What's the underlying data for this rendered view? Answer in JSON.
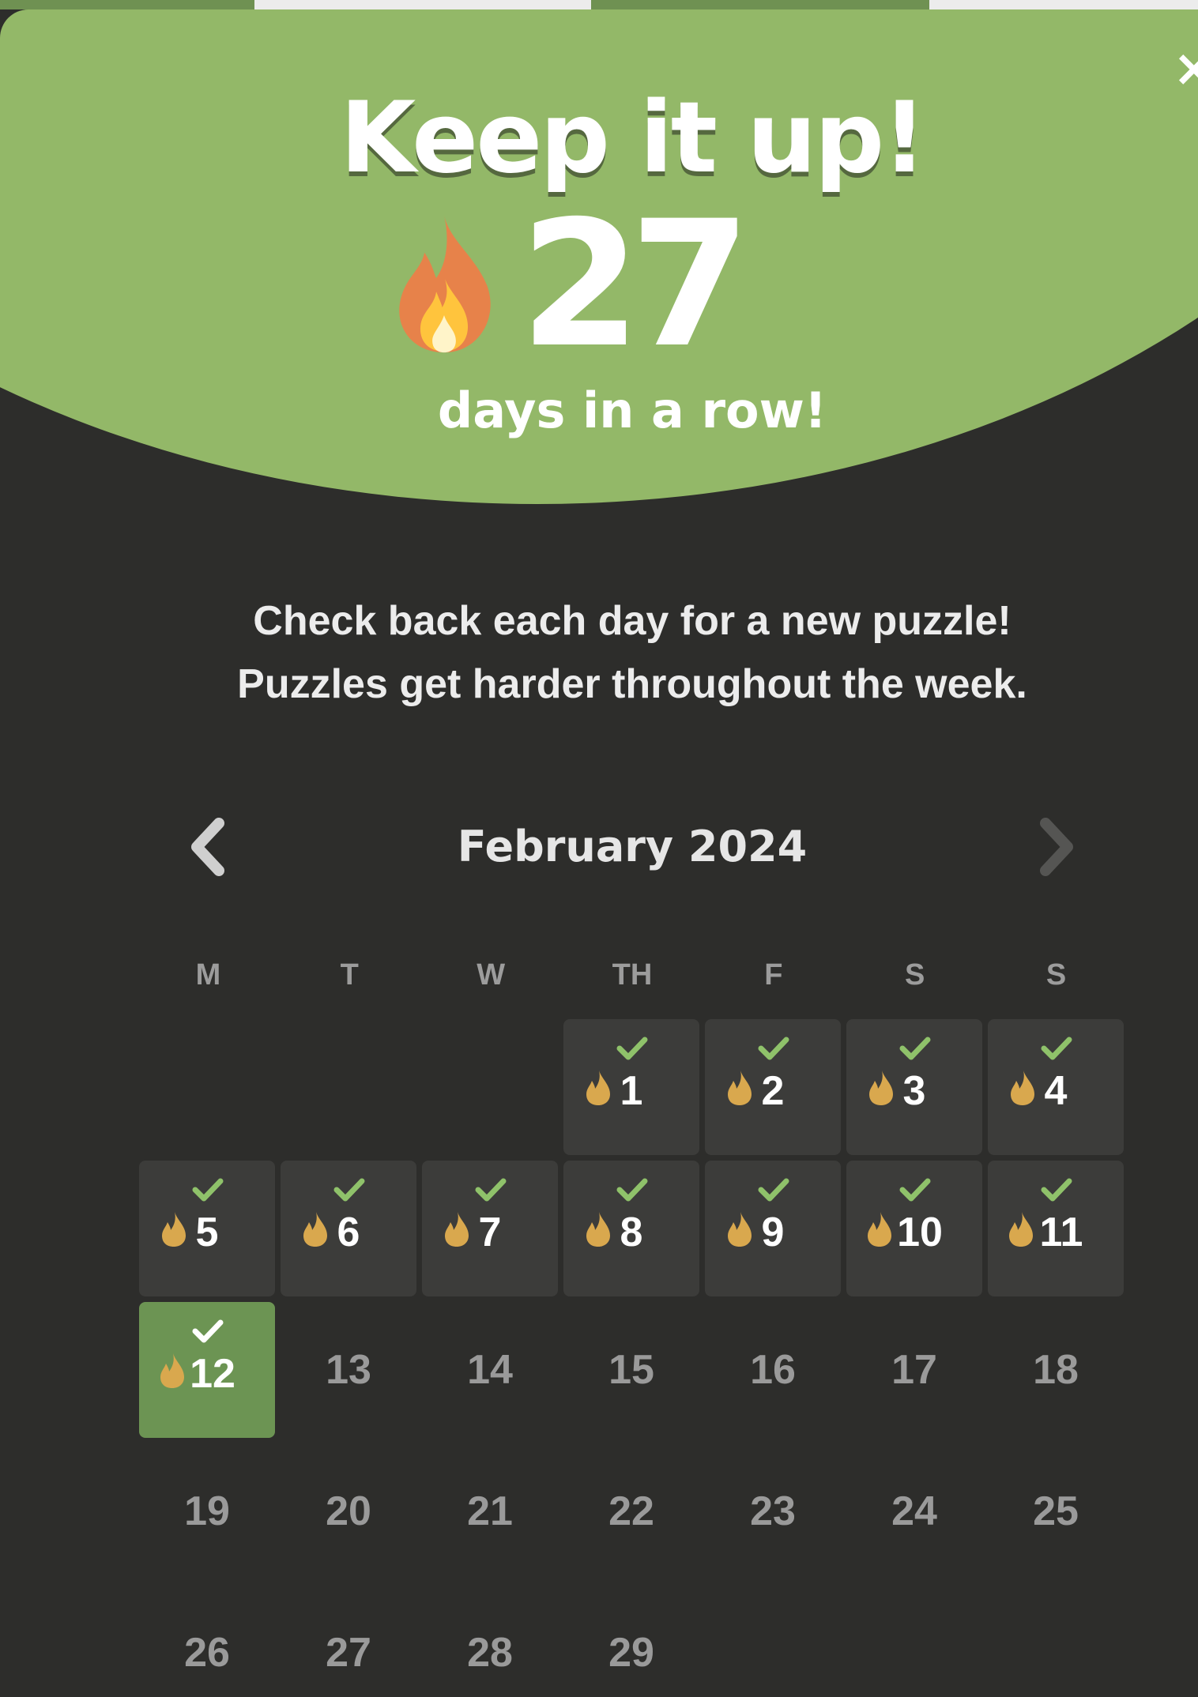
{
  "header": {
    "title": "Keep it up!",
    "streak_count": "27",
    "streak_caption": "days in a row!",
    "close_symbol": "×",
    "colors": {
      "hero": "#93b868",
      "background": "#2d2d2b",
      "flame_orange": "#e7824a",
      "flame_small": "#d9a84e"
    }
  },
  "message": {
    "line1": "Check back each day for a new puzzle!",
    "line2": "Puzzles get harder throughout the week."
  },
  "calendar": {
    "month_label": "February 2024",
    "prev_icon": "chevron-left-icon",
    "next_icon": "chevron-right-icon",
    "weekdays": [
      "M",
      "T",
      "W",
      "TH",
      "F",
      "S",
      "S"
    ],
    "leading_empty": 3,
    "days": [
      {
        "day": "1",
        "state": "done"
      },
      {
        "day": "2",
        "state": "done"
      },
      {
        "day": "3",
        "state": "done"
      },
      {
        "day": "4",
        "state": "done"
      },
      {
        "day": "5",
        "state": "done"
      },
      {
        "day": "6",
        "state": "done"
      },
      {
        "day": "7",
        "state": "done"
      },
      {
        "day": "8",
        "state": "done"
      },
      {
        "day": "9",
        "state": "done"
      },
      {
        "day": "10",
        "state": "done"
      },
      {
        "day": "11",
        "state": "done"
      },
      {
        "day": "12",
        "state": "today"
      },
      {
        "day": "13",
        "state": "future"
      },
      {
        "day": "14",
        "state": "future"
      },
      {
        "day": "15",
        "state": "future"
      },
      {
        "day": "16",
        "state": "future"
      },
      {
        "day": "17",
        "state": "future"
      },
      {
        "day": "18",
        "state": "future"
      },
      {
        "day": "19",
        "state": "future"
      },
      {
        "day": "20",
        "state": "future"
      },
      {
        "day": "21",
        "state": "future"
      },
      {
        "day": "22",
        "state": "future"
      },
      {
        "day": "23",
        "state": "future"
      },
      {
        "day": "24",
        "state": "future"
      },
      {
        "day": "25",
        "state": "future"
      },
      {
        "day": "26",
        "state": "future"
      },
      {
        "day": "27",
        "state": "future"
      },
      {
        "day": "28",
        "state": "future"
      },
      {
        "day": "29",
        "state": "future"
      }
    ]
  }
}
